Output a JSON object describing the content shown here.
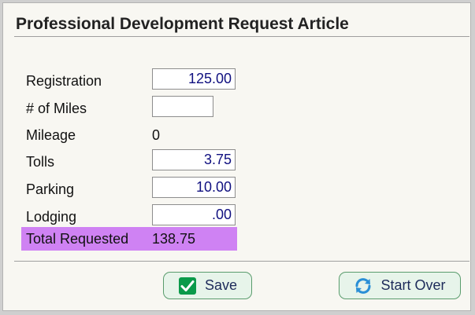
{
  "title": "Professional Development Request Article",
  "fields": {
    "registration": {
      "label": "Registration",
      "value": "125.00"
    },
    "miles": {
      "label": "# of Miles",
      "value": ""
    },
    "mileage": {
      "label": "Mileage",
      "value": "0"
    },
    "tolls": {
      "label": "Tolls",
      "value": "3.75"
    },
    "parking": {
      "label": "Parking",
      "value": "10.00"
    },
    "lodging": {
      "label": "Lodging",
      "value": ".00"
    }
  },
  "total": {
    "label": "Total Requested",
    "value": "138.75"
  },
  "buttons": {
    "save": "Save",
    "start_over": "Start Over"
  },
  "colors": {
    "total_highlight": "#cf82f3",
    "button_bg": "#e7f4ea",
    "input_text": "#101080",
    "save_icon": "#0b9a4a",
    "refresh_icon": "#2a8fd6"
  },
  "icons": {
    "save": "checkmark-icon",
    "start_over": "refresh-icon"
  }
}
